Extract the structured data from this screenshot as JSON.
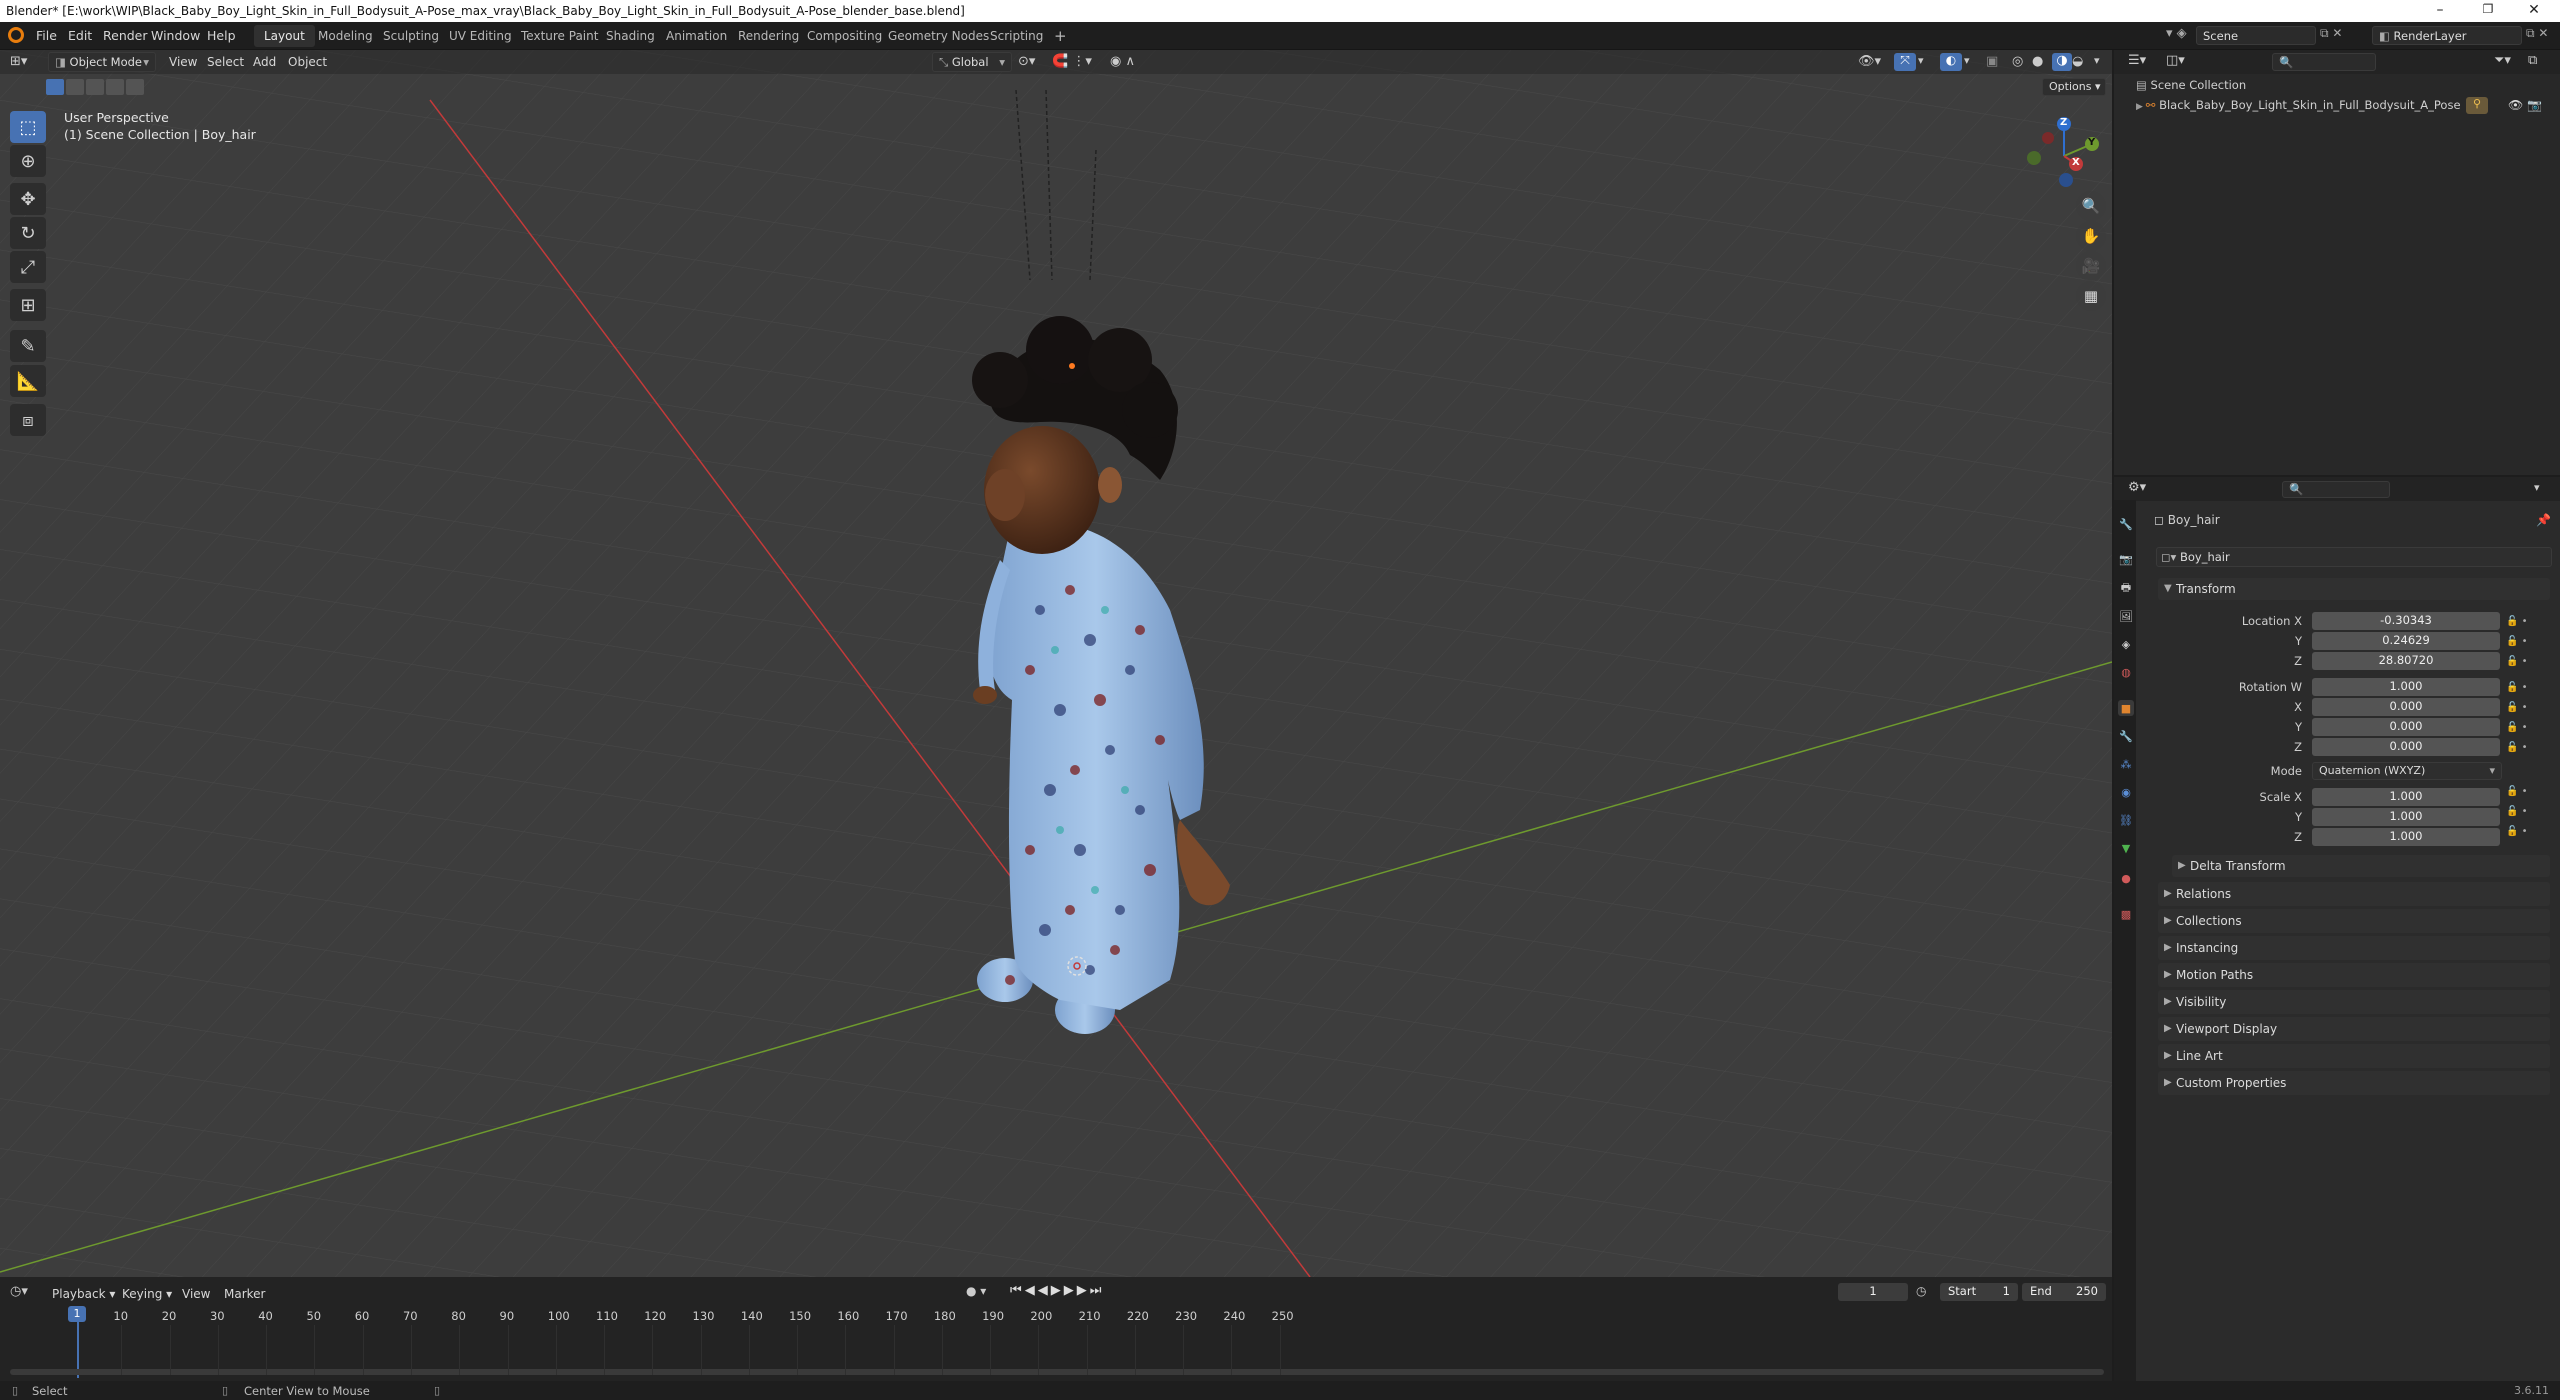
{
  "window": {
    "title": "Blender* [E:\\work\\WIP\\Black_Baby_Boy_Light_Skin_in_Full_Bodysuit_A-Pose_max_vray\\Black_Baby_Boy_Light_Skin_in_Full_Bodysuit_A-Pose_blender_base.blend]",
    "minimize": "–",
    "maximize": "❐",
    "close": "✕"
  },
  "menu": {
    "items": [
      "File",
      "Edit",
      "Render",
      "Window",
      "Help"
    ],
    "workspaces": [
      "Layout",
      "Modeling",
      "Sculpting",
      "UV Editing",
      "Texture Paint",
      "Shading",
      "Animation",
      "Rendering",
      "Compositing",
      "Geometry Nodes",
      "Scripting"
    ],
    "active_workspace": "Layout",
    "add_workspace": "+",
    "scene": "Scene",
    "render_layer": "RenderLayer"
  },
  "viewport": {
    "mode": "Object Mode",
    "menus": [
      "View",
      "Select",
      "Add",
      "Object"
    ],
    "orientation": "Global",
    "options_label": "Options",
    "overlay_line1": "User Perspective",
    "overlay_line2": "(1) Scene Collection | Boy_hair",
    "gizmo": {
      "z": "Z",
      "y": "Y",
      "x": "X"
    }
  },
  "outliner": {
    "root": "Scene Collection",
    "object": "Black_Baby_Boy_Light_Skin_in_Full_Bodysuit_A_Pose"
  },
  "properties": {
    "object_name": "Boy_hair",
    "data_name": "Boy_hair",
    "transform_title": "Transform",
    "location": {
      "label": "Location X",
      "y_label": "Y",
      "z_label": "Z",
      "x": "-0.30343",
      "y": "0.24629",
      "z": "28.80720"
    },
    "rotation": {
      "label": "Rotation W",
      "x_label": "X",
      "y_label": "Y",
      "z_label": "Z",
      "w": "1.000",
      "x": "0.000",
      "y": "0.000",
      "z": "0.000"
    },
    "mode_label": "Mode",
    "mode_value": "Quaternion (WXYZ)",
    "scale": {
      "label": "Scale X",
      "y_label": "Y",
      "z_label": "Z",
      "x": "1.000",
      "y": "1.000",
      "z": "1.000"
    },
    "delta": "Delta Transform",
    "panels": [
      "Relations",
      "Collections",
      "Instancing",
      "Motion Paths",
      "Visibility",
      "Viewport Display",
      "Line Art",
      "Custom Properties"
    ]
  },
  "timeline": {
    "menus": [
      "Playback",
      "Keying",
      "View",
      "Marker"
    ],
    "current_frame": "1",
    "start_label": "Start",
    "start": "1",
    "end_label": "End",
    "end": "250",
    "ticks": [
      "10",
      "20",
      "30",
      "40",
      "50",
      "60",
      "70",
      "80",
      "90",
      "100",
      "110",
      "120",
      "130",
      "140",
      "150",
      "160",
      "170",
      "180",
      "190",
      "200",
      "210",
      "220",
      "230",
      "240",
      "250"
    ],
    "playhead_label": "1"
  },
  "status": {
    "select": "Select",
    "center": "Center View to Mouse",
    "version": "3.6.11"
  },
  "colors": {
    "accent": "#4772b3",
    "x_axis": "#c23a3a",
    "y_axis": "#6e9a2e",
    "z_axis": "#2f6fd0",
    "object_orange": "#e0852f"
  }
}
